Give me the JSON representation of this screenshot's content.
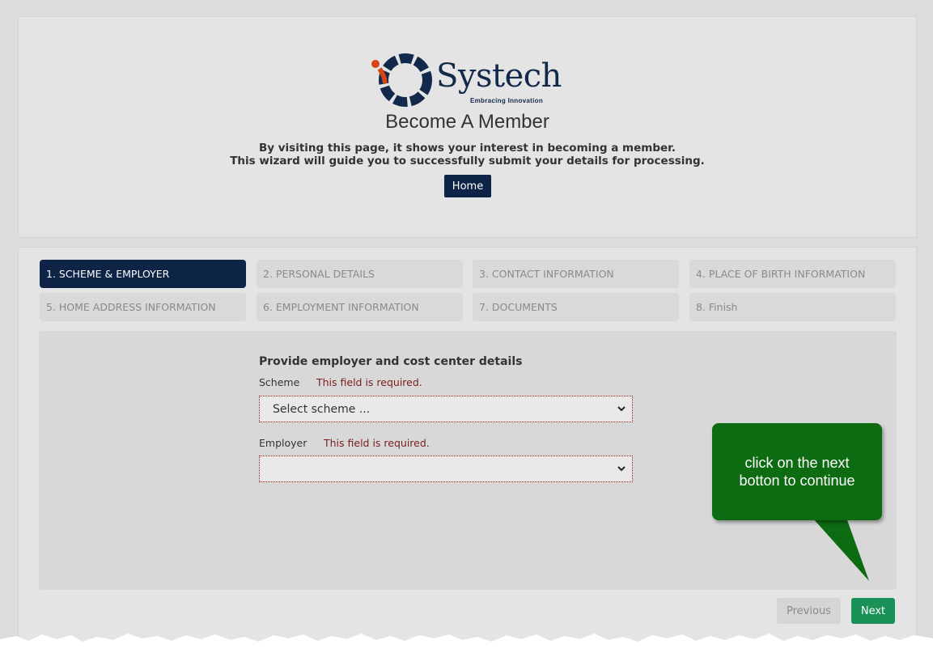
{
  "logo": {
    "text": "Systech",
    "tagline": "Embracing Innovation"
  },
  "header": {
    "title": "Become A Member",
    "intro_line1": "By visiting this page, it shows your interest in becoming a member.",
    "intro_line2": "This wizard will guide you to successfully submit your details for processing.",
    "home_label": "Home"
  },
  "steps": [
    {
      "label": "1. SCHEME & EMPLOYER",
      "active": true
    },
    {
      "label": "2. PERSONAL DETAILS",
      "active": false
    },
    {
      "label": "3. CONTACT INFORMATION",
      "active": false
    },
    {
      "label": "4. PLACE OF BIRTH INFORMATION",
      "active": false
    },
    {
      "label": "5. HOME ADDRESS INFORMATION",
      "active": false
    },
    {
      "label": "6. EMPLOYMENT INFORMATION",
      "active": false
    },
    {
      "label": "7. DOCUMENTS",
      "active": false
    },
    {
      "label": "8. Finish",
      "active": false
    }
  ],
  "form": {
    "title": "Provide employer and cost center details",
    "scheme_label": "Scheme",
    "scheme_error": "This field is required.",
    "scheme_value": "Select scheme ...",
    "employer_label": "Employer",
    "employer_error": "This field is required.",
    "employer_value": ""
  },
  "callout": {
    "line1": "click on the next",
    "line2": "botton to continue"
  },
  "nav": {
    "previous_label": "Previous",
    "next_label": "Next"
  },
  "colors": {
    "primary": "#0e2446",
    "success": "#1a9156",
    "callout": "#0d6b12",
    "error": "#7a1c1c"
  }
}
